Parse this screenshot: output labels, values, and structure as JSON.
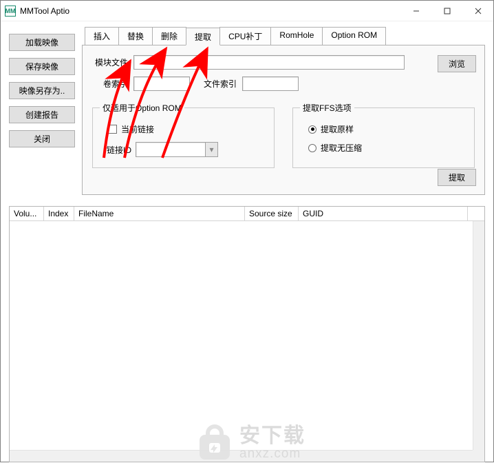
{
  "app": {
    "icon_text": "MM",
    "title": "MMTool Aptio"
  },
  "sidebar": {
    "buttons": [
      {
        "label": "加载映像"
      },
      {
        "label": "保存映像"
      },
      {
        "label": "映像另存为.."
      },
      {
        "label": "创建报告"
      },
      {
        "label": "关闭"
      }
    ]
  },
  "tabs": {
    "items": [
      {
        "label": "插入"
      },
      {
        "label": "替换"
      },
      {
        "label": "删除"
      },
      {
        "label": "提取"
      },
      {
        "label": "CPU补丁"
      },
      {
        "label": "RomHole"
      },
      {
        "label": "Option ROM"
      }
    ],
    "active_index": 3
  },
  "form": {
    "module_file_label": "模块文件",
    "module_file_value": "",
    "browse_label": "浏览",
    "vol_index_label": "卷索引",
    "vol_index_value": "",
    "file_index_label": "文件索引",
    "file_index_value": "",
    "group_option_rom": {
      "legend": "仅适用于Option ROM",
      "current_link_label": "当前链接",
      "current_link_checked": false,
      "link_id_label": "链接ID",
      "link_id_value": ""
    },
    "group_ffs": {
      "legend": "提取FFS选项",
      "opt_raw": "提取原样",
      "opt_uncompressed": "提取无压缩",
      "selected": "raw"
    },
    "extract_label": "提取"
  },
  "table": {
    "columns": [
      {
        "label": "Volu..."
      },
      {
        "label": "Index"
      },
      {
        "label": "FileName"
      },
      {
        "label": "Source size"
      },
      {
        "label": "GUID"
      }
    ],
    "rows": []
  },
  "watermark": {
    "cn": "安下载",
    "en": "anxz.com"
  }
}
